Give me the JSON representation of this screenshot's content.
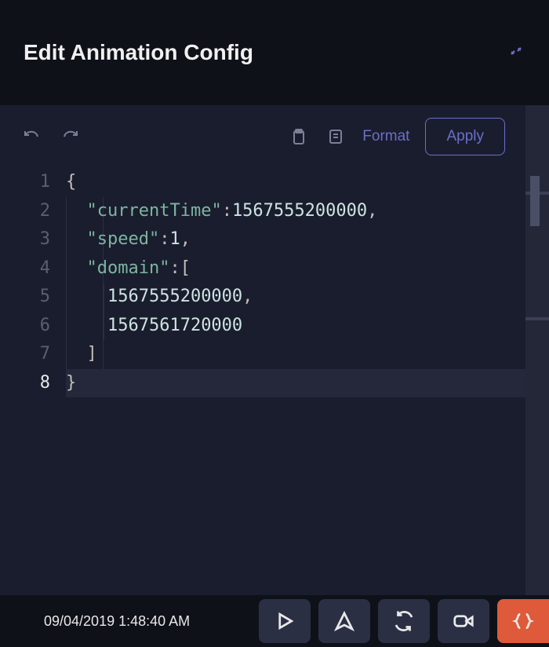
{
  "header": {
    "title": "Edit Animation Config"
  },
  "toolbar": {
    "format_label": "Format",
    "apply_label": "Apply"
  },
  "editor": {
    "lines": [
      {
        "n": "1",
        "indent": 0,
        "tokens": [
          [
            "brace",
            "{"
          ]
        ]
      },
      {
        "n": "2",
        "indent": 1,
        "tokens": [
          [
            "key",
            "\"currentTime\""
          ],
          [
            "punc",
            ": "
          ],
          [
            "num",
            "1567555200000"
          ],
          [
            "punc",
            ","
          ]
        ]
      },
      {
        "n": "3",
        "indent": 1,
        "tokens": [
          [
            "key",
            "\"speed\""
          ],
          [
            "punc",
            ": "
          ],
          [
            "num",
            "1"
          ],
          [
            "punc",
            ","
          ]
        ]
      },
      {
        "n": "4",
        "indent": 1,
        "tokens": [
          [
            "key",
            "\"domain\""
          ],
          [
            "punc",
            ": "
          ],
          [
            "brace",
            "["
          ]
        ]
      },
      {
        "n": "5",
        "indent": 2,
        "tokens": [
          [
            "num",
            "1567555200000"
          ],
          [
            "punc",
            ","
          ]
        ]
      },
      {
        "n": "6",
        "indent": 2,
        "tokens": [
          [
            "num",
            "1567561720000"
          ]
        ]
      },
      {
        "n": "7",
        "indent": 1,
        "tokens": [
          [
            "brace",
            "]"
          ]
        ]
      },
      {
        "n": "8",
        "indent": 0,
        "tokens": [
          [
            "brace",
            "}"
          ]
        ],
        "active": true
      }
    ]
  },
  "bottombar": {
    "timestamp": "09/04/2019 1:48:40 AM"
  }
}
